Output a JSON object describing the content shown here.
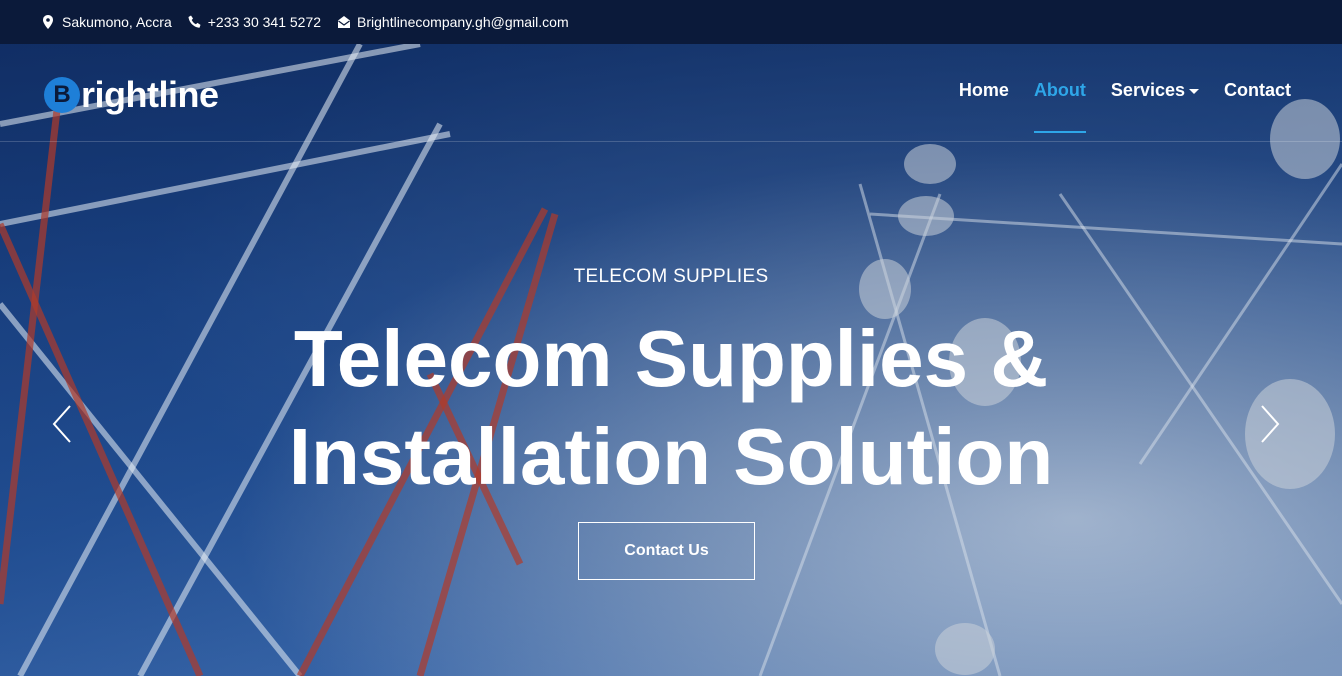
{
  "topbar": {
    "location": "Sakumono, Accra",
    "phone": "+233 30 341 5272",
    "email": "Brightlinecompany.gh@gmail.com",
    "icons": [
      "map-pin-icon",
      "phone-icon",
      "envelope-open-icon"
    ]
  },
  "brand": {
    "logo_letter": "B",
    "logo_text": "rightline",
    "accent": "#1e7fd8"
  },
  "nav": {
    "items": [
      {
        "label": "Home",
        "active": false
      },
      {
        "label": "About",
        "active": true
      },
      {
        "label": "Services",
        "active": false,
        "dropdown": true
      },
      {
        "label": "Contact",
        "active": false
      }
    ],
    "active_color": "#2ea6e8"
  },
  "hero": {
    "eyebrow": "TELECOM SUPPLIES",
    "headline_line1": "Telecom Supplies &",
    "headline_line2": "Installation Solution",
    "cta_label": "Contact Us",
    "prev_icon": "chevron-left-icon",
    "next_icon": "chevron-right-icon"
  },
  "colors": {
    "topbar_bg": "#0b1a3a",
    "text": "#ffffff"
  }
}
